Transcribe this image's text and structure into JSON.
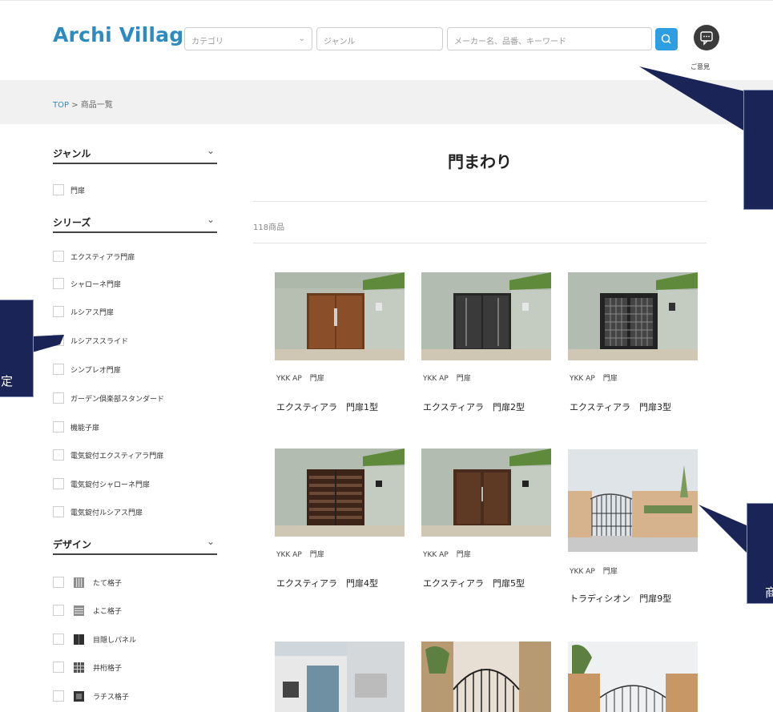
{
  "header": {
    "logo": "Archi Village",
    "category_placeholder": "カテゴリ",
    "genre_placeholder": "ジャンル",
    "search_placeholder": "メーカー名、品番、キーワード",
    "opinion_label": "ご意見"
  },
  "breadcrumb": {
    "top": "TOP",
    "sep": " > ",
    "current": "商品一覧"
  },
  "sidebar": {
    "genre": {
      "title": "ジャンル",
      "items": [
        "門扉"
      ]
    },
    "series": {
      "title": "シリーズ",
      "items": [
        "エクスティアラ門扉",
        "シャローネ門扉",
        "ルシアス門扉",
        "ルシアススライド",
        "シンプレオ門扉",
        "ガーデン倶楽部スタンダード",
        "機能子扉",
        "電気錠付エクスティアラ門扉",
        "電気錠付シャローネ門扉",
        "電気錠付ルシアス門扉"
      ]
    },
    "design": {
      "title": "デザイン",
      "items": [
        "たて格子",
        "よこ格子",
        "目隠しパネル",
        "井桁格子",
        "ラチス格子"
      ]
    }
  },
  "main": {
    "title": "門まわり",
    "count": "118商品",
    "products": [
      {
        "maker": "YKK AP",
        "genre": "門扉",
        "name": "エクスティアラ　門扉1型"
      },
      {
        "maker": "YKK AP",
        "genre": "門扉",
        "name": "エクスティアラ　門扉2型"
      },
      {
        "maker": "YKK AP",
        "genre": "門扉",
        "name": "エクスティアラ　門扉3型"
      },
      {
        "maker": "YKK AP",
        "genre": "門扉",
        "name": "エクスティアラ　門扉4型"
      },
      {
        "maker": "YKK AP",
        "genre": "門扉",
        "name": "エクスティアラ　門扉5型"
      },
      {
        "maker": "YKK AP",
        "genre": "門扉",
        "name": "トラディシオン　門扉9型"
      }
    ]
  },
  "callouts": {
    "left": "定",
    "right_bottom": "商"
  },
  "colors": {
    "brand": "#2e8bc0",
    "search_button": "#2e9ee3",
    "callout_bg": "#1b2457"
  }
}
